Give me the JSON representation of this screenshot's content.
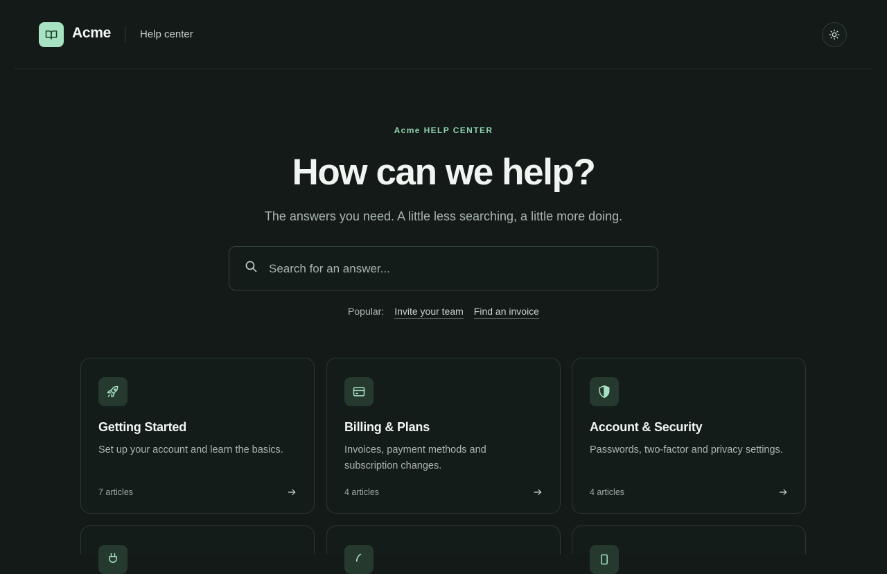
{
  "header": {
    "brand": "Acme",
    "subbrand": "Help center",
    "logo_icon": "book-icon",
    "theme_icon": "sun-icon"
  },
  "hero": {
    "eyebrow": "Acme HELP CENTER",
    "title": "How can we help?",
    "subtitle": "The answers you need. A little less searching, a little more doing."
  },
  "search": {
    "placeholder": "Search for an answer...",
    "value": "",
    "icon": "search-icon"
  },
  "popular": {
    "label": "Popular:",
    "links": [
      "Invite your team",
      "Find an invoice"
    ]
  },
  "categories": [
    {
      "title": "Getting Started",
      "description": "Set up your account and learn the basics.",
      "count": "7 articles",
      "icon": "rocket-icon"
    },
    {
      "title": "Billing & Plans",
      "description": "Invoices, payment methods and subscription changes.",
      "count": "4 articles",
      "icon": "credit-card-icon"
    },
    {
      "title": "Account & Security",
      "description": "Passwords, two-factor and privacy settings.",
      "count": "4 articles",
      "icon": "shield-icon"
    }
  ],
  "colors": {
    "background": "#131a18",
    "accent": "#a7e3c3",
    "accent_text": "#8fd3ad",
    "card_icon_bg": "#26392f"
  }
}
